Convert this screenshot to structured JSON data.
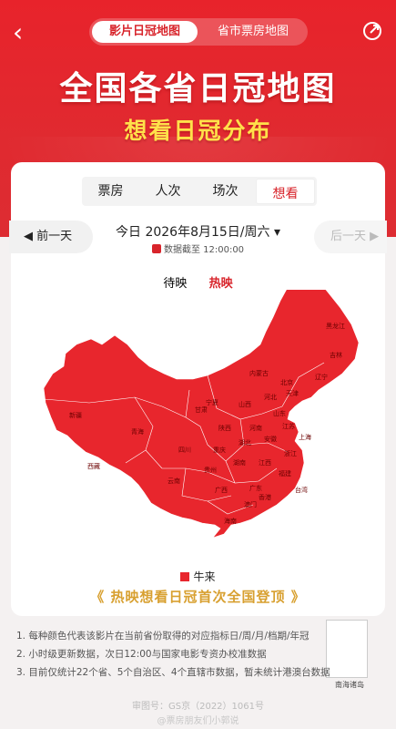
{
  "header": {
    "back_glyph": "‹",
    "seg_active": "影片日冠地图",
    "seg_inactive": "省市票房地图"
  },
  "hero": {
    "title": "全国各省日冠地图",
    "subtitle": "想看日冠分布"
  },
  "card": {
    "tabs": [
      "票房",
      "人次",
      "场次",
      "想看"
    ],
    "active_tab_index": 3,
    "prev_label": "◀ 前一天",
    "next_label": "后一天 ▶",
    "date_text": "今日  2026年8月15日/周六 ▾",
    "stamp_text": "数据截至 12:00:00",
    "sub_tabs": [
      "待映",
      "热映"
    ],
    "sub_active": "热映",
    "legend_label": "牛来",
    "banner_text": "《 热映想看日冠首次全国登顶 》",
    "south_sea_label": "南海诸岛",
    "provinces": [
      "新疆",
      "西藏",
      "青海",
      "甘肃",
      "内蒙古",
      "黑龙江",
      "吉林",
      "辽宁",
      "北京",
      "天津",
      "河北",
      "山西",
      "山东",
      "河南",
      "陕西",
      "宁夏",
      "四川",
      "重庆",
      "湖北",
      "安徽",
      "江苏",
      "上海",
      "浙江",
      "江西",
      "湖南",
      "贵州",
      "云南",
      "广西",
      "广东",
      "福建",
      "台湾",
      "香港",
      "澳门",
      "海南"
    ]
  },
  "notes": [
    "1.  每种颜色代表该影片在当前省份取得的对应指标日/周/月/档期/年冠",
    "2.  小时级更新数据，次日12:00与国家电影专资办校准数据",
    "3.  目前仅统计22个省、5个自治区、4个直辖市数据，暂未统计港澳台数据"
  ],
  "footer": {
    "icp": "审图号：GS京（2022）1061号",
    "watermark": "@票房朋友们小郭说"
  },
  "colors": {
    "brand_red": "#e8232b",
    "map_red": "#e8262d",
    "gold": "#ffe14a"
  }
}
